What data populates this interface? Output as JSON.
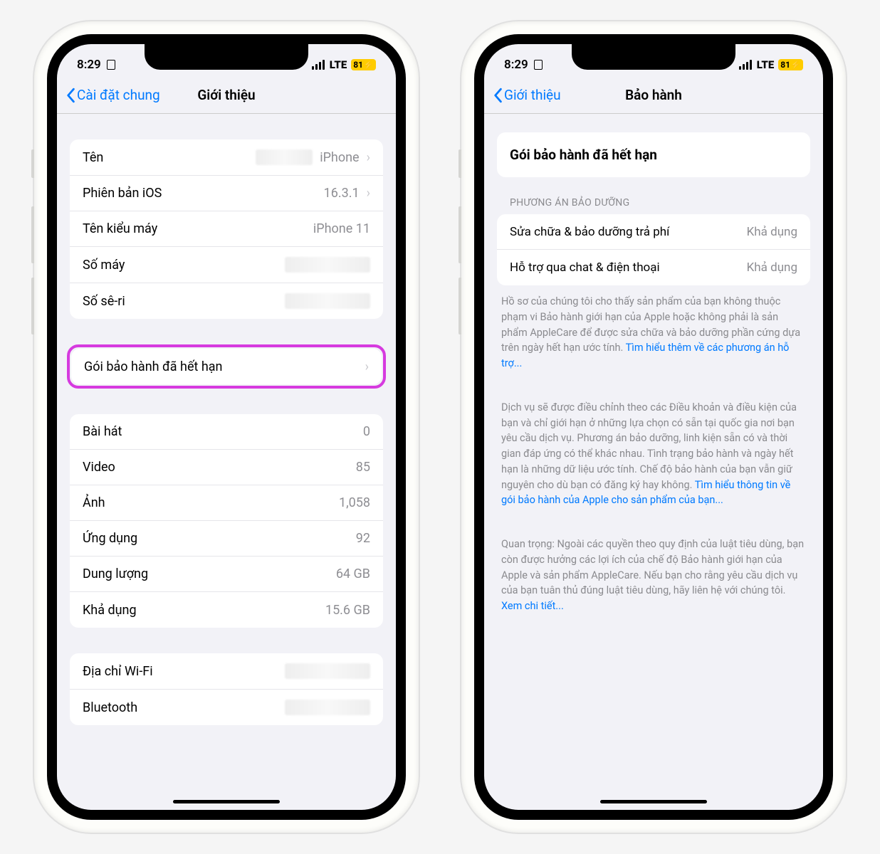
{
  "status": {
    "time": "8:29",
    "network": "LTE",
    "battery": "81"
  },
  "left": {
    "back": "Cài đặt chung",
    "title": "Giới thiệu",
    "group1": [
      {
        "label": "Tên",
        "value": "iPhone",
        "chevron": true,
        "blur_before": true
      },
      {
        "label": "Phiên bản iOS",
        "value": "16.3.1",
        "chevron": true
      },
      {
        "label": "Tên kiểu máy",
        "value": "iPhone 11"
      },
      {
        "label": "Số máy",
        "blur": true
      },
      {
        "label": "Số sê-ri",
        "blur": true
      }
    ],
    "warranty_row": {
      "label": "Gói bảo hành đã hết hạn"
    },
    "group3": [
      {
        "label": "Bài hát",
        "value": "0"
      },
      {
        "label": "Video",
        "value": "85"
      },
      {
        "label": "Ảnh",
        "value": "1,058"
      },
      {
        "label": "Ứng dụng",
        "value": "92"
      },
      {
        "label": "Dung lượng",
        "value": "64 GB"
      },
      {
        "label": "Khả dụng",
        "value": "15.6 GB"
      }
    ],
    "group4": [
      {
        "label": "Địa chỉ Wi-Fi",
        "blur": true
      },
      {
        "label": "Bluetooth",
        "blur": true
      }
    ]
  },
  "right": {
    "back": "Giới thiệu",
    "title": "Bảo hành",
    "header_card": "Gói bảo hành đã hết hạn",
    "section_header": "PHƯƠNG ÁN BẢO DƯỠNG",
    "options": [
      {
        "label": "Sửa chữa & bảo dưỡng trả phí",
        "value": "Khả dụng"
      },
      {
        "label": "Hỗ trợ qua chat & điện thoại",
        "value": "Khả dụng"
      }
    ],
    "para1_text": "Hồ sơ của chúng tôi cho thấy sản phẩm của bạn không thuộc phạm vi Bảo hành giới hạn của Apple hoặc không phải là sản phẩm AppleCare để được sửa chữa và bảo dưỡng phần cứng dựa trên ngày hết hạn ước tính. ",
    "para1_link": "Tìm hiểu thêm về các phương án hỗ trợ...",
    "para2_text": "Dịch vụ sẽ được điều chỉnh theo các Điều khoản và điều kiện của bạn và chỉ giới hạn ở những lựa chọn có sẵn tại quốc gia nơi bạn yêu cầu dịch vụ. Phương án bảo dưỡng, linh kiện sẵn có và thời gian đáp ứng có thể khác nhau. Tình trạng bảo hành và ngày hết hạn là những dữ liệu ước tính. Chế độ bảo hành của bạn vẫn giữ nguyên cho dù bạn có đăng ký hay không. ",
    "para2_link": "Tìm hiểu thông tin về gói bảo hành của Apple cho sản phẩm của bạn...",
    "para3_text": "Quan trọng: Ngoài các quyền theo quy định của luật tiêu dùng, bạn còn được hưởng các lợi ích của chế độ Bảo hành giới hạn của Apple và sản phẩm AppleCare. Nếu bạn cho rằng yêu cầu dịch vụ của bạn tuân thủ đúng luật tiêu dùng, hãy liên hệ với chúng tôi. ",
    "para3_link": "Xem chi tiết..."
  }
}
